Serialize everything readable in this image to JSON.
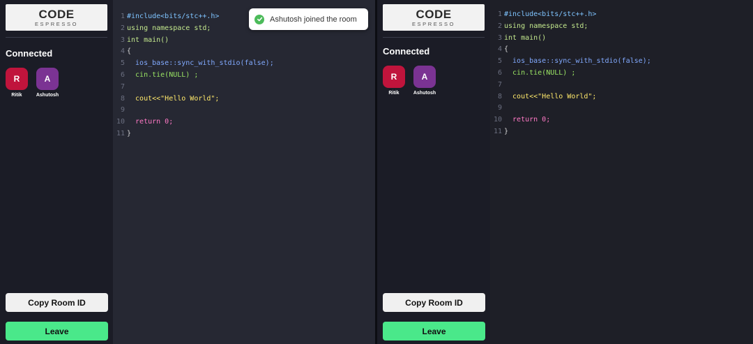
{
  "logo": {
    "main": "CODE",
    "sub": "ESPRESSO"
  },
  "sidebar": {
    "heading": "Connected",
    "clients": [
      {
        "initial": "R",
        "name": "Ritik",
        "color": "#c0143c"
      },
      {
        "initial": "A",
        "name": "Ashutosh",
        "color": "#7b3393"
      }
    ],
    "copy_label": "Copy Room ID",
    "leave_label": "Leave"
  },
  "toast": {
    "message": "Ashutosh joined the room",
    "icon": "check-circle-icon",
    "color": "#4cbb5a"
  },
  "code": {
    "line_numbers": [
      "1",
      "2",
      "3",
      "4",
      "5",
      "6",
      "7",
      "8",
      "9",
      "10",
      "11"
    ],
    "lines": [
      "#include<bits/stc++.h>",
      "using namespace std;",
      "int main()",
      "{",
      "  ios_base::sync_with_stdio(false);",
      "  cin.tie(NULL) ;",
      "",
      "  cout<<\"Hello World\";",
      "",
      "  return 0;",
      "}"
    ]
  },
  "colors": {
    "leave": "#4ae88a",
    "copy": "#f0f0f0",
    "sidebar": "#1b1c26",
    "editor": "#262833"
  }
}
